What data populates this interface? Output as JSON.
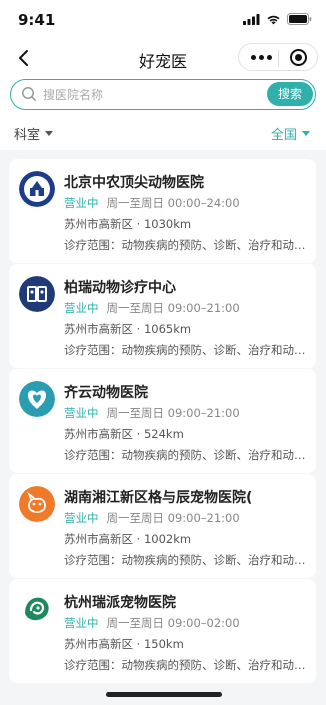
{
  "status_bar": {
    "time": "9:41"
  },
  "nav": {
    "title": "好宠医"
  },
  "search": {
    "placeholder": "搜医院名称",
    "value": "",
    "button_label": "搜索"
  },
  "filters": {
    "department_label": "科室",
    "region_label": "全国"
  },
  "hospitals": [
    {
      "name": "北京中农顶尖动物医院",
      "status": "营业中",
      "hours": "周一至周日 00:00–24:00",
      "location": "苏州市高新区 · 1030km",
      "scope": "诊疗范围：动物疾病的预防、诊断、治疗和动物..."
    },
    {
      "name": "柏瑞动物诊疗中心",
      "status": "营业中",
      "hours": "周一至周日 09:00–21:00",
      "location": "苏州市高新区 · 1065km",
      "scope": "诊疗范围：动物疾病的预防、诊断、治疗和动物..."
    },
    {
      "name": "齐云动物医院",
      "status": "营业中",
      "hours": "周一至周日 09:00–21:00",
      "location": "苏州市高新区 · 524km",
      "scope": "诊疗范围：动物疾病的预防、诊断、治疗和动物..."
    },
    {
      "name": "湖南湘江新区格与辰宠物医院(",
      "status": "营业中",
      "hours": "周一至周日 09:00–21:00",
      "location": "苏州市高新区 · 1002km",
      "scope": "诊疗范围：动物疾病的预防、诊断、治疗和动物..."
    },
    {
      "name": "杭州瑞派宠物医院",
      "status": "营业中",
      "hours": "周一至周日 09:00–02:00",
      "location": "苏州市高新区 · 150km",
      "scope": "诊疗范围：动物疾病的预防、诊断、治疗和动物..."
    }
  ],
  "colors": {
    "accent": "#2fb0ad",
    "background": "#f4f5f7"
  }
}
